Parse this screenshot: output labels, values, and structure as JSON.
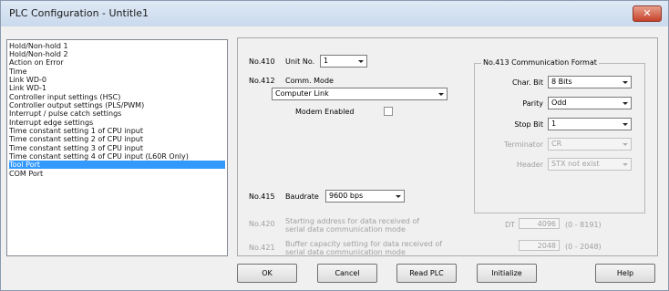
{
  "window": {
    "title": "PLC Configuration - Untitle1",
    "close_glyph": "✕"
  },
  "settings_list": {
    "selected_index": 15,
    "items": [
      "Hold/Non-hold 1",
      "Hold/Non-hold 2",
      "Action on Error",
      "Time",
      "Link WD-0",
      "Link WD-1",
      "Controller input settings (HSC)",
      "Controller output settings (PLS/PWM)",
      "Interrupt / pulse catch settings",
      "Interrupt edge settings",
      "Time constant setting 1 of CPU input",
      "Time constant setting 2 of CPU input",
      "Time constant setting 3 of CPU input",
      "Time constant setting 4 of CPU input (L60R Only)",
      "Tool Port",
      "COM Port"
    ]
  },
  "tool_port": {
    "no410_label": "No.410",
    "unit_no_label": "Unit No.",
    "unit_no_value": "1",
    "no412_label": "No.412",
    "comm_mode_label": "Comm. Mode",
    "comm_mode_value": "Computer Link",
    "modem_label": "Modem Enabled",
    "modem_checked": false,
    "no415_label": "No.415",
    "baudrate_label": "Baudrate",
    "baudrate_value": "9600 bps",
    "no420_label": "No.420",
    "no420_text": [
      "Starting address for data received of",
      "serial data communication mode"
    ],
    "no420_prefix": "DT",
    "no420_value": "4096",
    "no420_range": "(0 - 8191)",
    "no421_label": "No.421",
    "no421_text": [
      "Buffer capacity setting for data received of",
      "serial data communication mode"
    ],
    "no421_value": "2048",
    "no421_range": "(0 - 2048)"
  },
  "comm_format": {
    "legend": "No.413 Communication Format",
    "char_bit_label": "Char. Bit",
    "char_bit_value": "8 Bits",
    "parity_label": "Parity",
    "parity_value": "Odd",
    "stop_bit_label": "Stop Bit",
    "stop_bit_value": "1",
    "terminator_label": "Terminator",
    "terminator_value": "CR",
    "header_label": "Header",
    "header_value": "STX not exist"
  },
  "buttons": {
    "ok": "OK",
    "cancel": "Cancel",
    "read_plc": "Read PLC",
    "initialize": "Initialize",
    "help": "Help"
  },
  "colors": {
    "selection": "#3399ff",
    "disabled_text": "#a0a0a0"
  }
}
